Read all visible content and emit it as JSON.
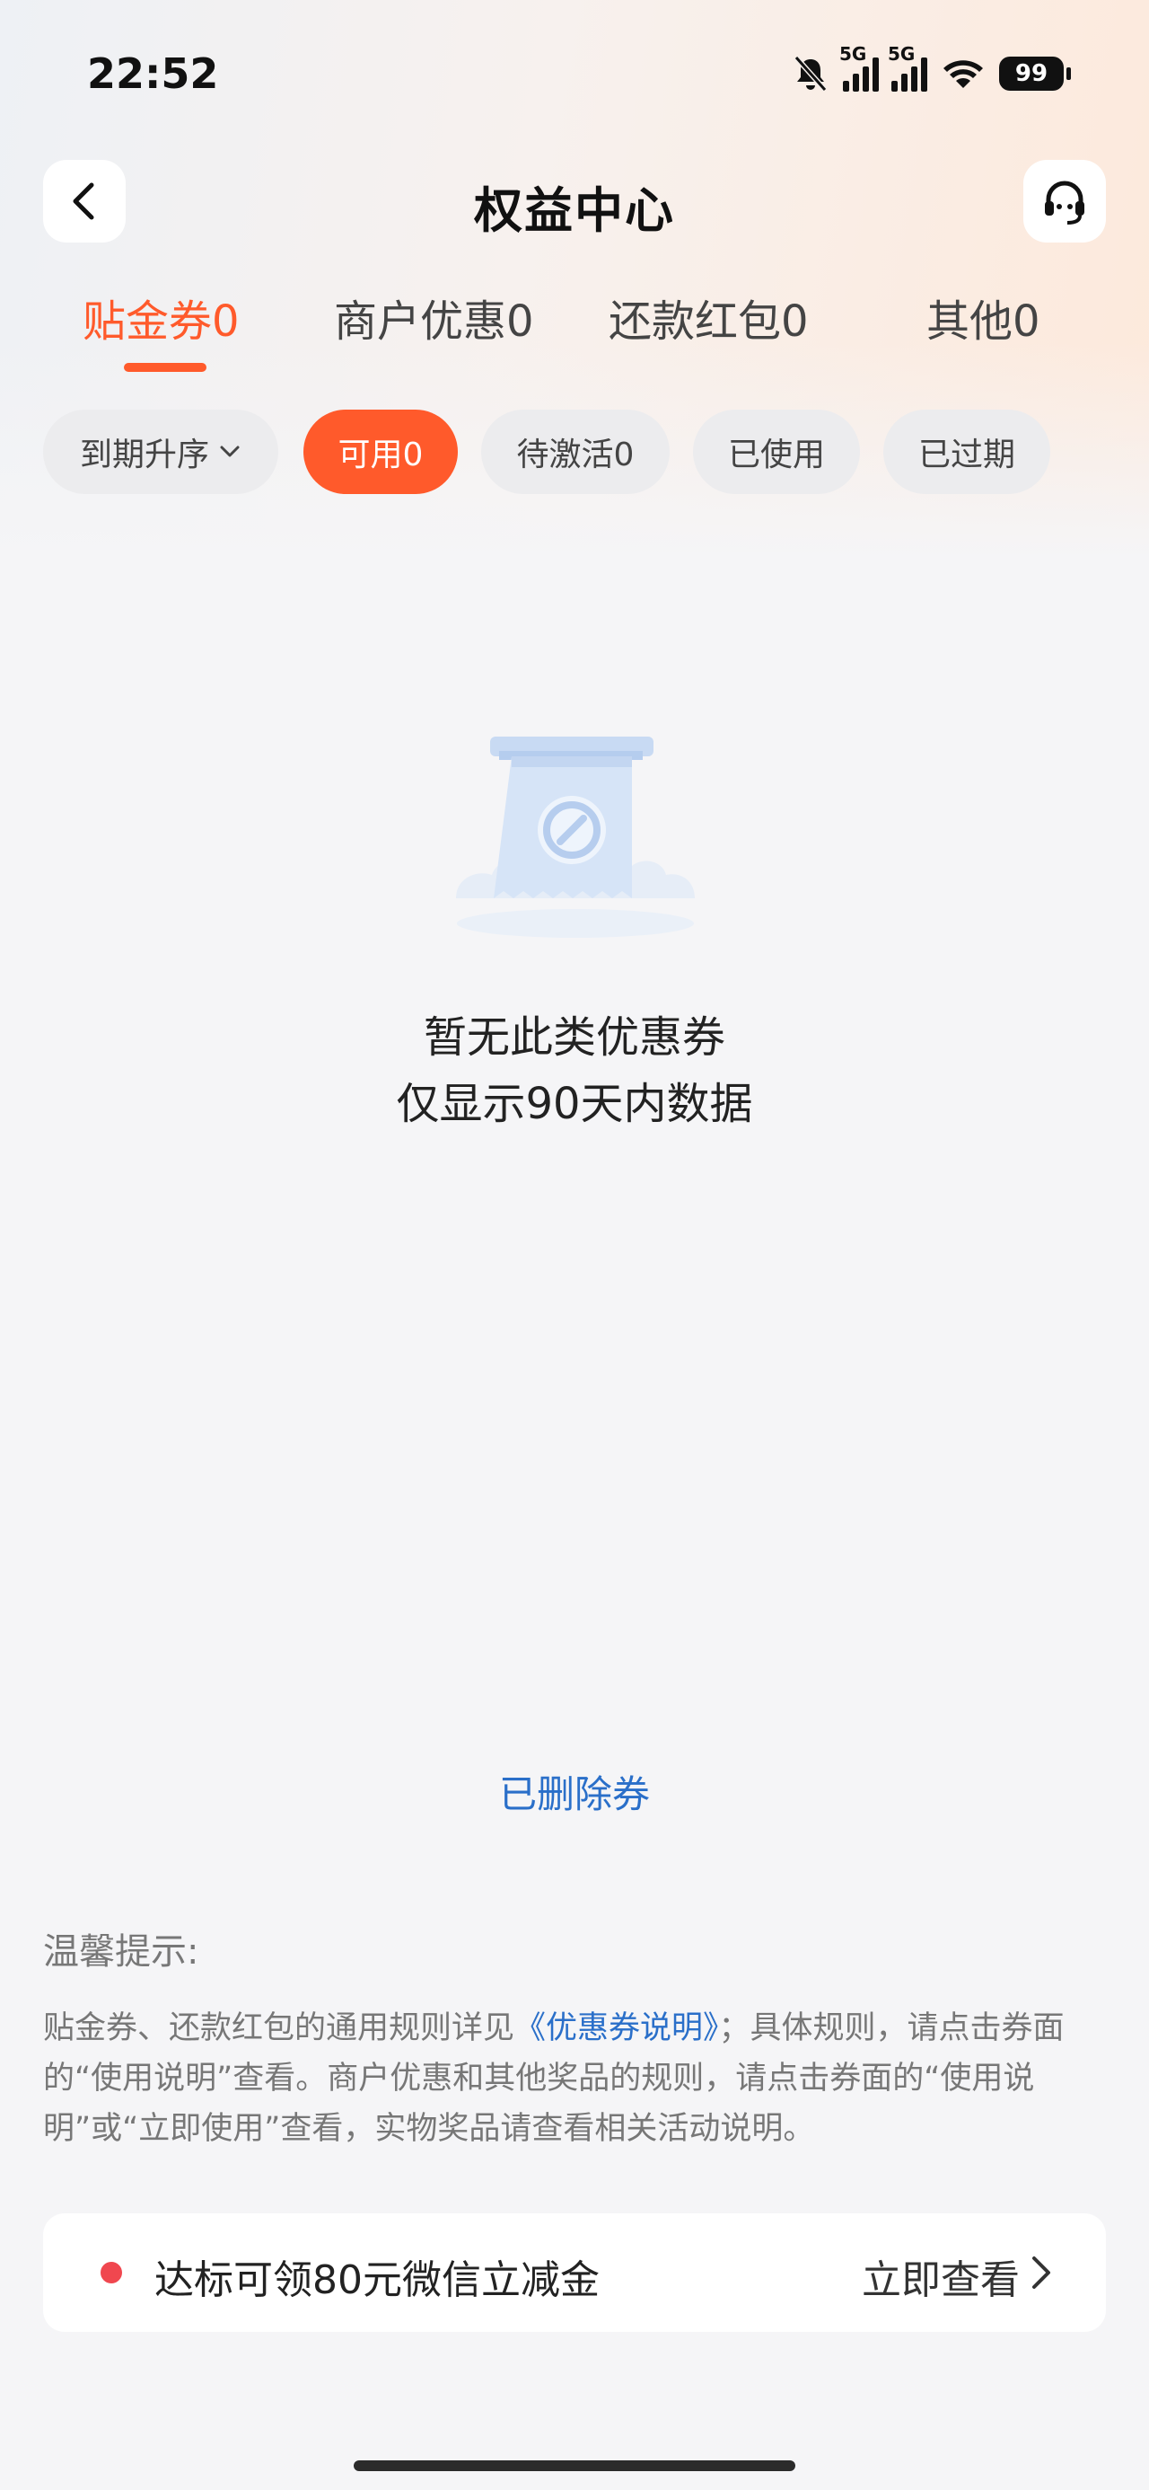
{
  "status_bar": {
    "time": "22:52",
    "network_1": "5G",
    "network_2": "5G",
    "battery": "99",
    "icons": [
      "mute-bell-icon",
      "signal-icon",
      "signal-icon",
      "wifi-icon",
      "battery-icon"
    ]
  },
  "nav": {
    "title": "权益中心",
    "back_icon": "chevron-left-icon",
    "service_icon": "headset-icon"
  },
  "tabs": [
    {
      "label": "贴金券0",
      "active": true
    },
    {
      "label": "商户优惠0",
      "active": false
    },
    {
      "label": "还款红包0",
      "active": false
    },
    {
      "label": "其他0",
      "active": false
    }
  ],
  "filters": {
    "sort_label": "到期升序",
    "chips": [
      {
        "label": "可用0",
        "active": true
      },
      {
        "label": "待激活0",
        "active": false
      },
      {
        "label": "已使用",
        "active": false
      },
      {
        "label": "已过期",
        "active": false
      }
    ]
  },
  "empty_state": {
    "line1": "暂无此类优惠券",
    "line2": "仅显示90天内数据"
  },
  "deleted_link": "已删除券",
  "tips": {
    "title": "温馨提示:",
    "text_before_link": "贴金券、还款红包的通用规则详见",
    "link": "《优惠券说明》",
    "text_after_link": "；具体规则，请点击券面的“使用说明”查看。商户优惠和其他奖品的规则，请点击券面的“使用说明”或“立即使用”查看，实物奖品请查看相关活动说明。"
  },
  "promo": {
    "text": "达标可领80元微信立减金",
    "action": "立即查看"
  },
  "colors": {
    "accent": "#ff5a2b",
    "link": "#2a6fc9",
    "dot": "#f0474f"
  }
}
